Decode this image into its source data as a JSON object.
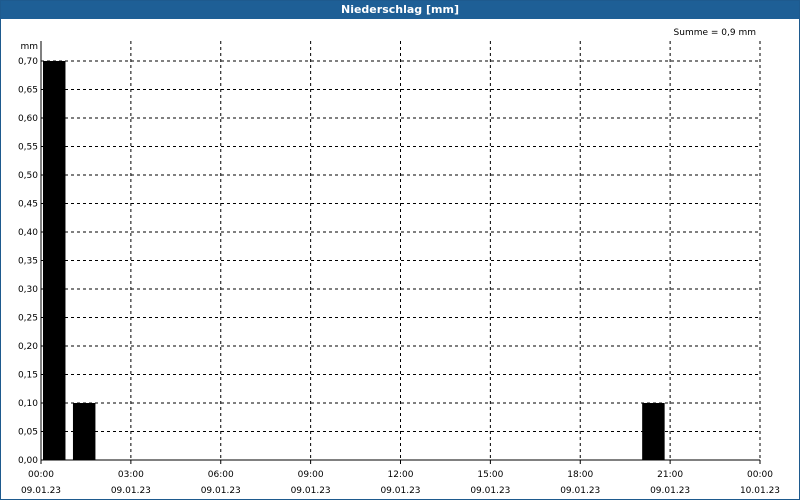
{
  "window": {
    "title": "Niederschlag [mm]"
  },
  "chart_data": {
    "type": "bar",
    "title": "Niederschlag [mm]",
    "annotation": "Summe = 0,9 mm",
    "ylabel": "mm",
    "ylim": [
      0,
      0.7
    ],
    "yticks": [
      "0,00",
      "0,05",
      "0,10",
      "0,15",
      "0,20",
      "0,25",
      "0,30",
      "0,35",
      "0,40",
      "0,45",
      "0,50",
      "0,55",
      "0,60",
      "0,65",
      "0,70"
    ],
    "xticks": [
      {
        "time": "00:00",
        "date": "09.01.23"
      },
      {
        "time": "03:00",
        "date": "09.01.23"
      },
      {
        "time": "06:00",
        "date": "09.01.23"
      },
      {
        "time": "09:00",
        "date": "09.01.23"
      },
      {
        "time": "12:00",
        "date": "09.01.23"
      },
      {
        "time": "15:00",
        "date": "09.01.23"
      },
      {
        "time": "18:00",
        "date": "09.01.23"
      },
      {
        "time": "21:00",
        "date": "09.01.23"
      },
      {
        "time": "00:00",
        "date": "10.01.23"
      }
    ],
    "series": [
      {
        "bars": [
          {
            "start": "00:00",
            "end": "00:45",
            "value": 0.7
          },
          {
            "start": "01:00",
            "end": "01:45",
            "value": 0.1
          },
          {
            "start": "20:00",
            "end": "20:45",
            "value": 0.1
          }
        ]
      }
    ],
    "grid": true
  }
}
